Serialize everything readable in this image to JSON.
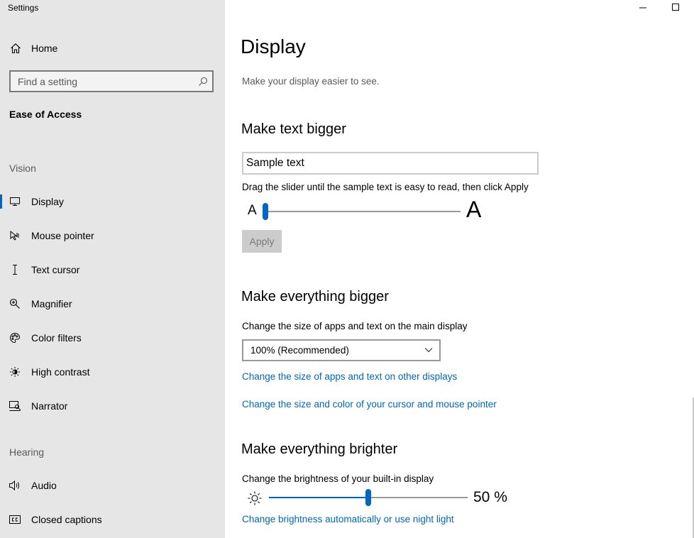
{
  "window": {
    "title": "Settings"
  },
  "sidebar": {
    "home_label": "Home",
    "search_placeholder": "Find a setting",
    "section_title": "Ease of Access",
    "groups": [
      {
        "label": "Vision"
      },
      {
        "label": "Hearing"
      }
    ],
    "items": [
      {
        "label": "Display",
        "icon": "monitor-icon",
        "active": true
      },
      {
        "label": "Mouse pointer",
        "icon": "mouse-pointer-icon"
      },
      {
        "label": "Text cursor",
        "icon": "text-cursor-icon"
      },
      {
        "label": "Magnifier",
        "icon": "magnifier-icon"
      },
      {
        "label": "Color filters",
        "icon": "palette-icon"
      },
      {
        "label": "High contrast",
        "icon": "high-contrast-icon"
      },
      {
        "label": "Narrator",
        "icon": "narrator-icon"
      },
      {
        "label": "Audio",
        "icon": "speaker-icon"
      },
      {
        "label": "Closed captions",
        "icon": "cc-icon"
      }
    ]
  },
  "main": {
    "title": "Display",
    "description": "Make your display easier to see.",
    "text_bigger": {
      "heading": "Make text bigger",
      "sample_text": "Sample text",
      "instruction": "Drag the slider until the sample text is easy to read, then click Apply",
      "small_label": "A",
      "large_label": "A",
      "slider_value": 0,
      "apply_label": "Apply"
    },
    "everything_bigger": {
      "heading": "Make everything bigger",
      "label": "Change the size of apps and text on the main display",
      "dropdown_value": "100% (Recommended)",
      "link_other_displays": "Change the size of apps and text on other displays",
      "link_cursor": "Change the size and color of your cursor and mouse pointer"
    },
    "brighter": {
      "heading": "Make everything brighter",
      "label": "Change the brightness of your built-in display",
      "brightness_value": 50,
      "brightness_text": "50 %",
      "link_night_light": "Change brightness automatically or use night light"
    }
  },
  "colors": {
    "accent": "#0067c0",
    "link": "#0067b8",
    "sidebar_bg": "#e6e6e6"
  }
}
